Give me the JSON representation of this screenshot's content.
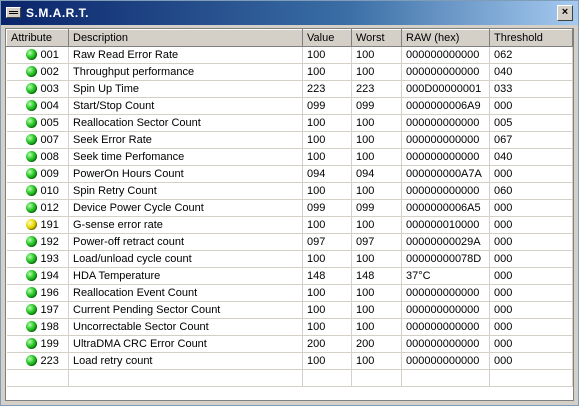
{
  "window": {
    "title": "S.M.A.R.T.",
    "close_glyph": "×"
  },
  "columns": [
    "Attribute",
    "Description",
    "Value",
    "Worst",
    "RAW (hex)",
    "Threshold"
  ],
  "status_colors": {
    "ok": "#22c322",
    "warning": "#e8d800"
  },
  "rows": [
    {
      "status": "ok",
      "id": "001",
      "desc": "Raw Read Error Rate",
      "value": "100",
      "worst": "100",
      "raw": "000000000000",
      "threshold": "062"
    },
    {
      "status": "ok",
      "id": "002",
      "desc": "Throughput performance",
      "value": "100",
      "worst": "100",
      "raw": "000000000000",
      "threshold": "040"
    },
    {
      "status": "ok",
      "id": "003",
      "desc": "Spin Up Time",
      "value": "223",
      "worst": "223",
      "raw": "000D00000001",
      "threshold": "033"
    },
    {
      "status": "ok",
      "id": "004",
      "desc": "Start/Stop Count",
      "value": "099",
      "worst": "099",
      "raw": "0000000006A9",
      "threshold": "000"
    },
    {
      "status": "ok",
      "id": "005",
      "desc": "Reallocation Sector Count",
      "value": "100",
      "worst": "100",
      "raw": "000000000000",
      "threshold": "005"
    },
    {
      "status": "ok",
      "id": "007",
      "desc": "Seek Error Rate",
      "value": "100",
      "worst": "100",
      "raw": "000000000000",
      "threshold": "067"
    },
    {
      "status": "ok",
      "id": "008",
      "desc": "Seek time Perfomance",
      "value": "100",
      "worst": "100",
      "raw": "000000000000",
      "threshold": "040"
    },
    {
      "status": "ok",
      "id": "009",
      "desc": "PowerOn Hours Count",
      "value": "094",
      "worst": "094",
      "raw": "000000000A7A",
      "threshold": "000"
    },
    {
      "status": "ok",
      "id": "010",
      "desc": "Spin Retry Count",
      "value": "100",
      "worst": "100",
      "raw": "000000000000",
      "threshold": "060"
    },
    {
      "status": "ok",
      "id": "012",
      "desc": "Device Power Cycle Count",
      "value": "099",
      "worst": "099",
      "raw": "0000000006A5",
      "threshold": "000"
    },
    {
      "status": "warning",
      "id": "191",
      "desc": "G-sense error rate",
      "value": "100",
      "worst": "100",
      "raw": "000000010000",
      "threshold": "000"
    },
    {
      "status": "ok",
      "id": "192",
      "desc": "Power-off retract count",
      "value": "097",
      "worst": "097",
      "raw": "00000000029A",
      "threshold": "000"
    },
    {
      "status": "ok",
      "id": "193",
      "desc": "Load/unload cycle count",
      "value": "100",
      "worst": "100",
      "raw": "00000000078D",
      "threshold": "000"
    },
    {
      "status": "ok",
      "id": "194",
      "desc": "HDA Temperature",
      "value": "148",
      "worst": "148",
      "raw": "37°C",
      "threshold": "000"
    },
    {
      "status": "ok",
      "id": "196",
      "desc": "Reallocation Event Count",
      "value": "100",
      "worst": "100",
      "raw": "000000000000",
      "threshold": "000"
    },
    {
      "status": "ok",
      "id": "197",
      "desc": "Current Pending Sector Count",
      "value": "100",
      "worst": "100",
      "raw": "000000000000",
      "threshold": "000"
    },
    {
      "status": "ok",
      "id": "198",
      "desc": "Uncorrectable Sector Count",
      "value": "100",
      "worst": "100",
      "raw": "000000000000",
      "threshold": "000"
    },
    {
      "status": "ok",
      "id": "199",
      "desc": "UltraDMA CRC Error Count",
      "value": "200",
      "worst": "200",
      "raw": "000000000000",
      "threshold": "000"
    },
    {
      "status": "ok",
      "id": "223",
      "desc": "Load retry count",
      "value": "100",
      "worst": "100",
      "raw": "000000000000",
      "threshold": "000"
    }
  ]
}
